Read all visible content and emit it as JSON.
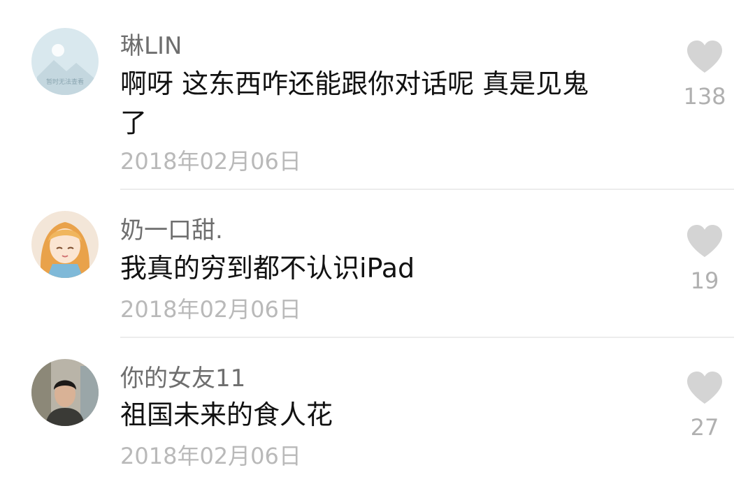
{
  "comments": [
    {
      "username": "琳LIN",
      "avatar_text": "暂时无法查看",
      "text": "啊呀 这东西咋还能跟你对话呢 真是见鬼了",
      "date": "2018年02月06日",
      "likes": "138",
      "like_icon": "heart-icon"
    },
    {
      "username": "奶一口甜.",
      "text": "我真的穷到都不认识iPad",
      "date": "2018年02月06日",
      "likes": "19",
      "like_icon": "heart-icon"
    },
    {
      "username": "你的女友11",
      "text": "祖国未来的食人花",
      "date": "2018年02月06日",
      "likes": "27",
      "like_icon": "heart-icon"
    }
  ],
  "colors": {
    "username": "#6e6e6e",
    "text": "#111111",
    "date": "#b9b9b9",
    "heart": "#d4d4d4",
    "count": "#b0b0b0",
    "divider": "#ececec"
  }
}
